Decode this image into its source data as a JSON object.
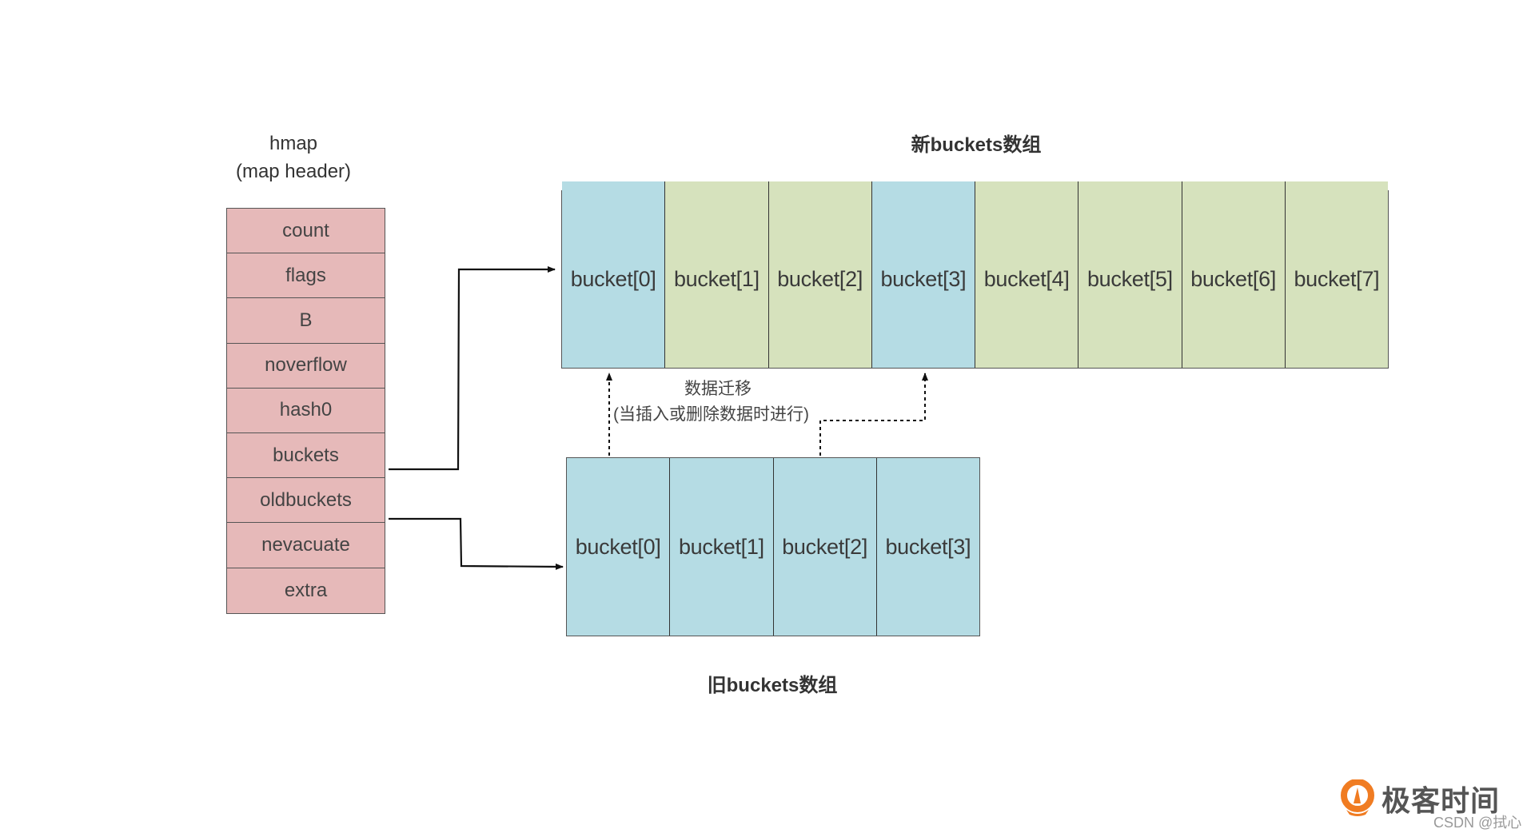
{
  "hmap": {
    "title": "hmap",
    "subtitle": "(map header)",
    "fields": [
      "count",
      "flags",
      "B",
      "noverflow",
      "hash0",
      "buckets",
      "oldbuckets",
      "nevacuate",
      "extra"
    ],
    "color": "#e6b9b9"
  },
  "new_buckets": {
    "title": "新buckets数组",
    "buckets": [
      {
        "label": "bucket[0]",
        "color": "#b5dce4"
      },
      {
        "label": "bucket[1]",
        "color": "#d6e2bd"
      },
      {
        "label": "bucket[2]",
        "color": "#d6e2bd"
      },
      {
        "label": "bucket[3]",
        "color": "#b5dce4"
      },
      {
        "label": "bucket[4]",
        "color": "#d6e2bd"
      },
      {
        "label": "bucket[5]",
        "color": "#d6e2bd"
      },
      {
        "label": "bucket[6]",
        "color": "#d6e2bd"
      },
      {
        "label": "bucket[7]",
        "color": "#d6e2bd"
      }
    ]
  },
  "old_buckets": {
    "title": "旧buckets数组",
    "buckets": [
      {
        "label": "bucket[0]",
        "color": "#b5dce4"
      },
      {
        "label": "bucket[1]",
        "color": "#b5dce4"
      },
      {
        "label": "bucket[2]",
        "color": "#b5dce4"
      },
      {
        "label": "bucket[3]",
        "color": "#b5dce4"
      }
    ]
  },
  "migration": {
    "line1": "数据迁移",
    "line2": "(当插入或删除数据时进行)"
  },
  "arrows": [
    {
      "from": "hmap.buckets",
      "to": "new_buckets",
      "style": "solid"
    },
    {
      "from": "hmap.oldbuckets",
      "to": "old_buckets",
      "style": "solid"
    },
    {
      "from": "old_buckets.bucket[0]",
      "to": "new_buckets.bucket[0]",
      "style": "dotted"
    },
    {
      "from": "old_buckets.bucket[2]",
      "to": "new_buckets.bucket[3]",
      "style": "dotted"
    }
  ],
  "branding": {
    "logo_text": "极客时间",
    "logo_color": "#f07c22",
    "watermark": "CSDN @拭心"
  }
}
